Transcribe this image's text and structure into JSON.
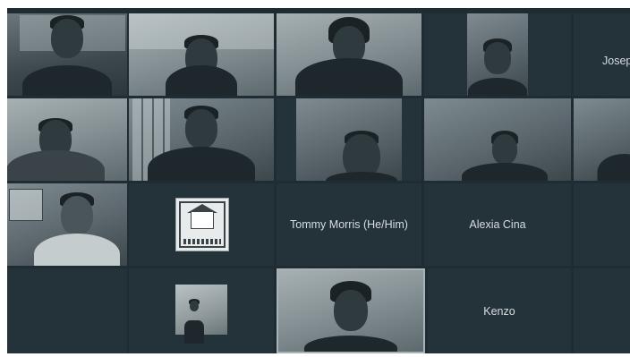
{
  "gallery": {
    "background": "#1f2c33",
    "participants": [
      {
        "id": "p1",
        "kind": "video",
        "name": ""
      },
      {
        "id": "p2",
        "kind": "video",
        "name": ""
      },
      {
        "id": "p3",
        "kind": "video",
        "name": ""
      },
      {
        "id": "p4",
        "kind": "video",
        "name": ""
      },
      {
        "id": "p5",
        "kind": "name",
        "name": "Josep"
      },
      {
        "id": "p6",
        "kind": "video",
        "name": ""
      },
      {
        "id": "p7",
        "kind": "video",
        "name": ""
      },
      {
        "id": "p8",
        "kind": "video",
        "name": ""
      },
      {
        "id": "p9",
        "kind": "video",
        "name": ""
      },
      {
        "id": "p10",
        "kind": "video",
        "name": ""
      },
      {
        "id": "p11",
        "kind": "video",
        "name": ""
      },
      {
        "id": "p12",
        "kind": "avatar",
        "name": ""
      },
      {
        "id": "p13",
        "kind": "name",
        "name": "Tommy Morris (He/Him)"
      },
      {
        "id": "p14",
        "kind": "name",
        "name": "Alexia Cina"
      },
      {
        "id": "p15",
        "kind": "empty",
        "name": ""
      },
      {
        "id": "p16",
        "kind": "empty",
        "name": ""
      },
      {
        "id": "p17",
        "kind": "avatar",
        "name": ""
      },
      {
        "id": "p18",
        "kind": "video",
        "name": "",
        "active": true
      },
      {
        "id": "p19",
        "kind": "name",
        "name": "Kenzo"
      },
      {
        "id": "p20",
        "kind": "empty",
        "name": ""
      }
    ]
  }
}
